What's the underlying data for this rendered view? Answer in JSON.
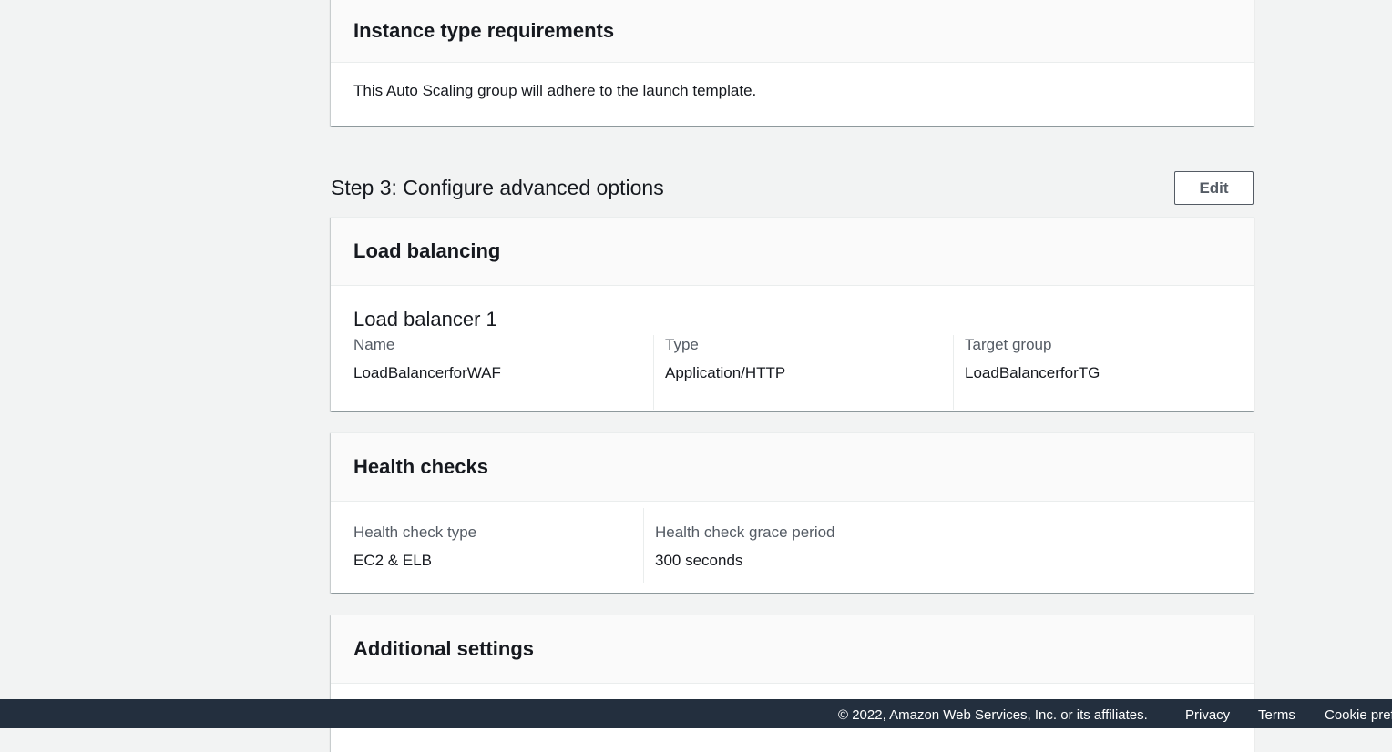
{
  "instance_requirements": {
    "title": "Instance type requirements",
    "description": "This Auto Scaling group will adhere to the launch template."
  },
  "step3": {
    "title": "Step 3: Configure advanced options",
    "edit_label": "Edit"
  },
  "load_balancing": {
    "title": "Load balancing",
    "load_balancer_title": "Load balancer 1",
    "fields": [
      {
        "label": "Name",
        "value": "LoadBalancerforWAF"
      },
      {
        "label": "Type",
        "value": "Application/HTTP"
      },
      {
        "label": "Target group",
        "value": "LoadBalancerforTG"
      }
    ]
  },
  "health_checks": {
    "title": "Health checks",
    "fields": [
      {
        "label": "Health check type",
        "value": "EC2 & ELB"
      },
      {
        "label": "Health check grace period",
        "value": "300 seconds"
      }
    ]
  },
  "additional_settings": {
    "title": "Additional settings"
  },
  "footer": {
    "copyright": "© 2022, Amazon Web Services, Inc. or its affiliates.",
    "links": [
      "Privacy",
      "Terms",
      "Cookie preferences"
    ]
  }
}
